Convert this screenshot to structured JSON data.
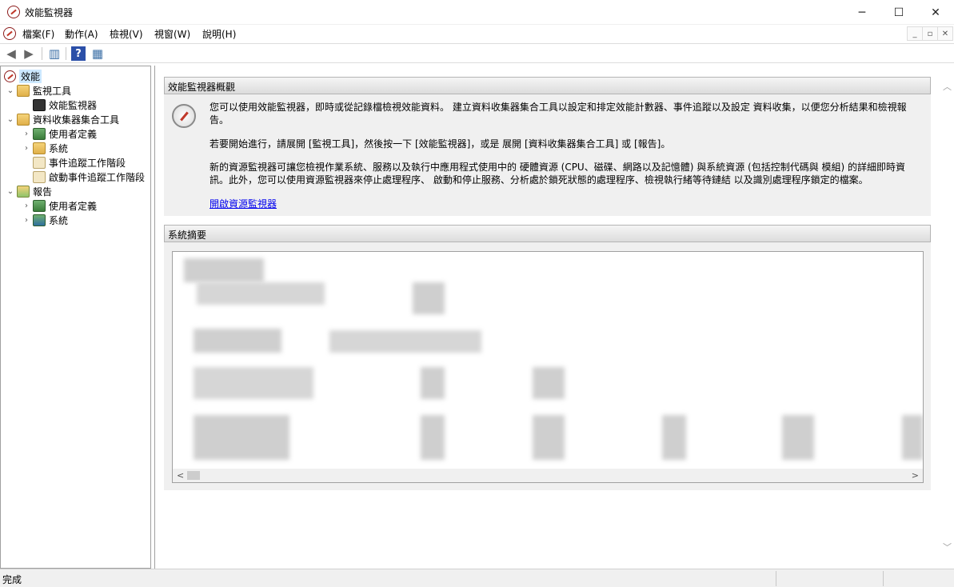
{
  "window": {
    "title": "效能監視器",
    "controls": {
      "minimize": "─",
      "maximize": "☐",
      "close": "✕"
    }
  },
  "menu": [
    {
      "label": "檔案(F)"
    },
    {
      "label": "動作(A)"
    },
    {
      "label": "檢視(V)"
    },
    {
      "label": "視窗(W)"
    },
    {
      "label": "說明(H)"
    }
  ],
  "mdi_controls": [
    "_",
    "▫",
    "✕"
  ],
  "toolbar": [
    {
      "name": "back-arrow-icon",
      "glyph": "◀"
    },
    {
      "name": "forward-arrow-icon",
      "glyph": "▶"
    },
    {
      "name": "show-hide-console-tree-icon",
      "glyph": "▥"
    },
    {
      "name": "help-icon",
      "glyph": "?"
    },
    {
      "name": "show-hide-action-pane-icon",
      "glyph": "▦"
    }
  ],
  "tree": {
    "root": "效能",
    "monitoring_tools": "監視工具",
    "performance_monitor": "效能監視器",
    "data_collector_sets": "資料收集器集合工具",
    "dcs_user_defined": "使用者定義",
    "dcs_system": "系統",
    "event_trace_sessions": "事件追蹤工作階段",
    "startup_event_trace_sessions": "啟動事件追蹤工作階段",
    "reports": "報告",
    "reports_user_defined": "使用者定義",
    "reports_system": "系統",
    "expand_glyph": "›",
    "collapse_glyph": "⌄"
  },
  "overview": {
    "header": "效能監視器概觀",
    "para1": "您可以使用效能監視器，即時或從記錄檔檢視效能資料。 建立資料收集器集合工具以設定和排定效能計數器、事件追蹤以及設定 資料收集，以便您分析結果和檢視報告。",
    "para2": "若要開始進行，請展開 [監視工具]，然後按一下 [效能監視器]，或是 展開 [資料收集器集合工具] 或 [報告]。",
    "para3": "新的資源監視器可讓您檢視作業系統、服務以及執行中應用程式使用中的 硬體資源 (CPU、磁碟、網路以及記憶體) 與系統資源 (包括控制代碼與 模組) 的詳細即時資訊。此外，您可以使用資源監視器來停止處理程序、 啟動和停止服務、分析處於鎖死狀態的處理程序、檢視執行緒等待鏈結 以及識別處理程序鎖定的檔案。",
    "link": "開啟資源監視器"
  },
  "summary": {
    "header": "系統摘要"
  },
  "scroll": {
    "up": "︿",
    "down": "﹀",
    "left": "<",
    "right": ">"
  },
  "status": {
    "text": "完成"
  }
}
